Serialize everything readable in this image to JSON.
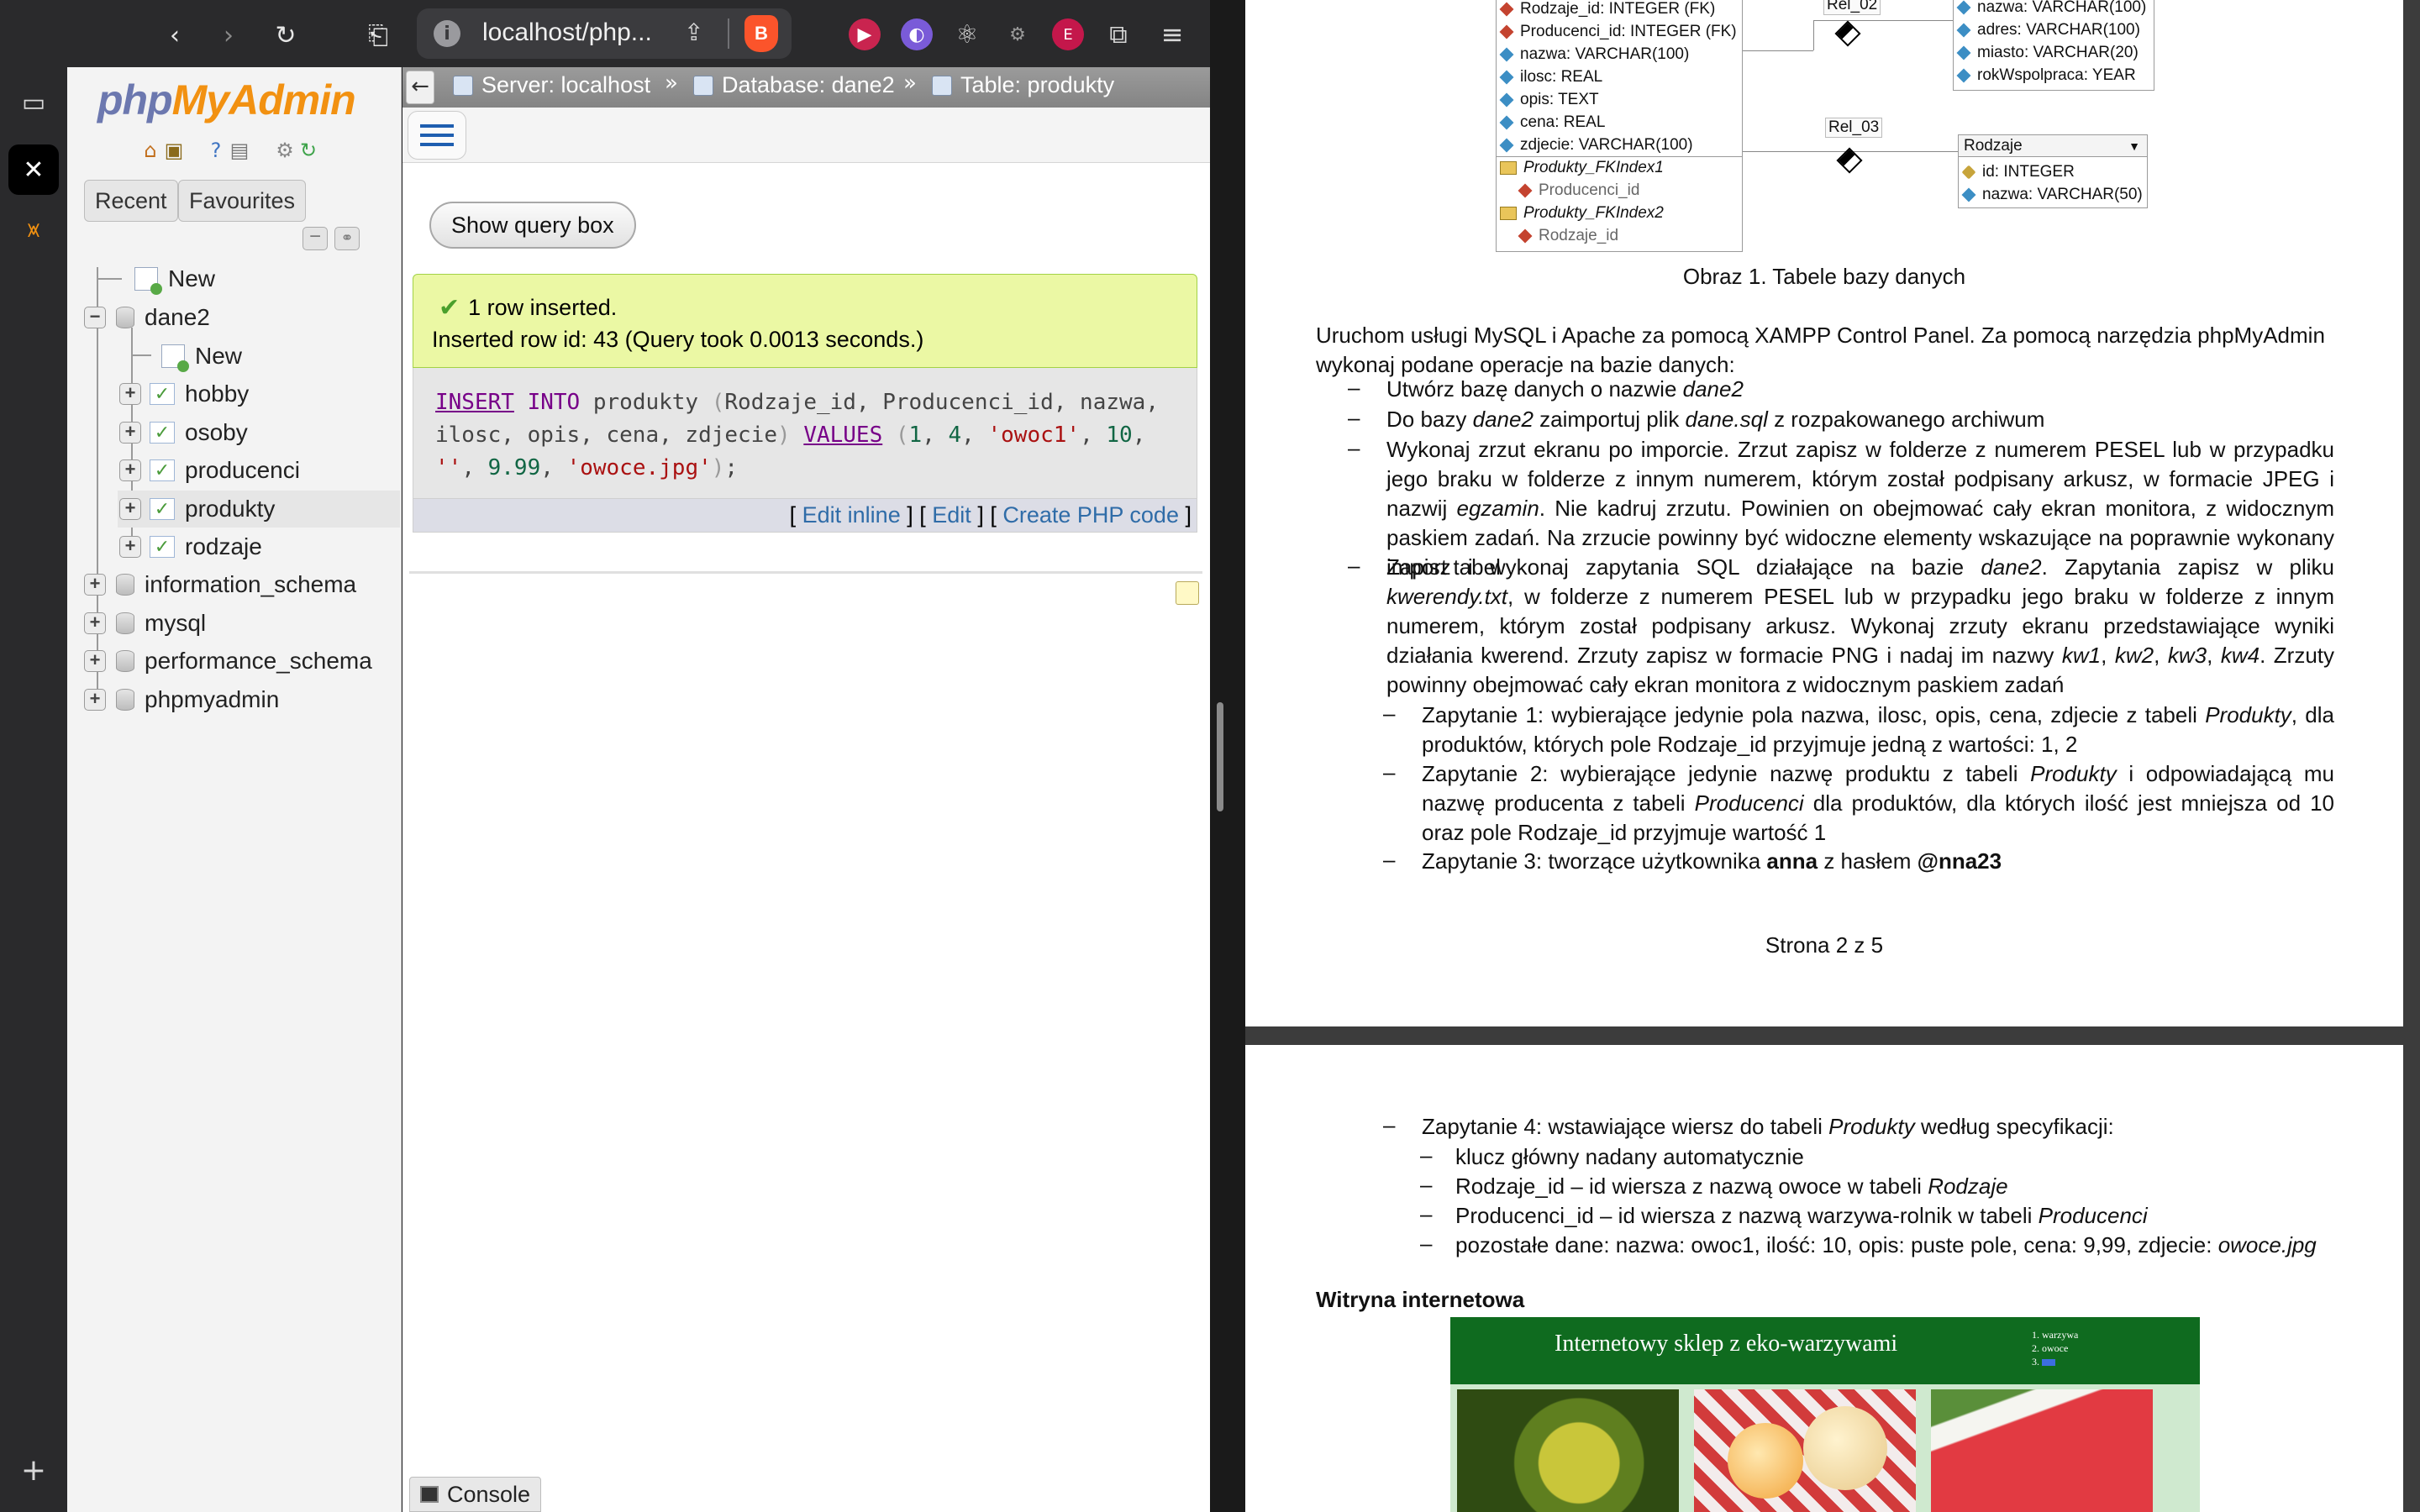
{
  "browser": {
    "url": "localhost/php...",
    "url_info_glyph": "i",
    "nav": {
      "back": "‹",
      "forward": "›",
      "reload": "↻",
      "bookmark": "⎗",
      "share": "⇪",
      "extensions": "⧉",
      "menu": "≡"
    },
    "extension_icons": [
      "play-icon",
      "palette-icon",
      "react-icon",
      "robot-icon",
      "elementor-icon",
      "puzzle-icon"
    ]
  },
  "sidebar_strip": {
    "panel_glyph": "▭",
    "close_glyph": "✕",
    "add_glyph": "+"
  },
  "pma": {
    "logo_php": "php",
    "logo_myadmin": "MyAdmin",
    "tabs": [
      "Recent",
      "Favourites"
    ],
    "tree": {
      "new_root": "New",
      "db_dane2": "dane2",
      "new_in_dane2": "New",
      "tables": [
        "hobby",
        "osoby",
        "producenci",
        "produkty",
        "rodzaje"
      ],
      "other_dbs": [
        "information_schema",
        "mysql",
        "performance_schema",
        "phpmyadmin"
      ],
      "toggle_expanded": "−",
      "toggle_collapsed": "+"
    },
    "breadcrumb": {
      "server": "Server: localhost",
      "database": "Database: dane2",
      "table": "Table: produkty",
      "separator": "»",
      "back_glyph": "←"
    },
    "show_query_box": "Show query box",
    "success": {
      "line1": "1 row inserted.",
      "line2": "Inserted row id: 43 (Query took 0.0013 seconds.)"
    },
    "sql": {
      "insert": "INSERT",
      "into": "INTO",
      "table": "produkty",
      "columns": "Rodzaje_id, Producenci_id, nazwa, ilosc, opis, cena, zdjecie",
      "values_kw": "VALUES",
      "v1": "1",
      "v2": "4",
      "v3": "'owoc1'",
      "v4": "10",
      "v5": "''",
      "v6": "9.99",
      "v7": "'owoce.jpg'"
    },
    "actions": {
      "open": "[",
      "edit_inline": "Edit inline",
      "mid1": "] [",
      "edit": "Edit",
      "mid2": "] [",
      "create_php": "Create PHP code",
      "close": "]"
    },
    "console": "Console"
  },
  "doc": {
    "er": {
      "produkty_rows": [
        "Rodzaje_id: INTEGER (FK)",
        "Producenci_id: INTEGER (FK)",
        "nazwa: VARCHAR(100)",
        "ilosc: REAL",
        "opis: TEXT",
        "cena: REAL",
        "zdjecie: VARCHAR(100)"
      ],
      "idx1": "Produkty_FKIndex1",
      "idx1_col": "Producenci_id",
      "idx2": "Produkty_FKIndex2",
      "idx2_col": "Rodzaje_id",
      "producenci_rows": [
        "nazwa: VARCHAR(100)",
        "adres: VARCHAR(100)",
        "miasto: VARCHAR(20)",
        "rokWspolpraca: YEAR"
      ],
      "rel02": "Rel_02",
      "rel03": "Rel_03",
      "rodzaje_title": "Rodzaje",
      "rodzaje_rows": [
        "id: INTEGER",
        "nazwa: VARCHAR(50)"
      ]
    },
    "caption": "Obraz 1. Tabele bazy danych",
    "intro": "Uruchom usługi MySQL i Apache za pomocą XAMPP Control Panel. Za pomocą narzędzia phpMyAdmin wykonaj podane operacje na bazie danych:",
    "dash": "–",
    "items": {
      "i1_a": "Utwórz bazę danych o nazwie ",
      "i1_b": "dane2",
      "i2_a": "Do bazy ",
      "i2_b": "dane2",
      "i2_c": " zaimportuj plik ",
      "i2_d": "dane.sql",
      "i2_e": " z rozpakowanego archiwum",
      "i3_a": "Wykonaj zrzut ekranu po imporcie. Zrzut zapisz w folderze z numerem PESEL lub w przypadku jego braku w folderze z innym numerem, którym został podpisany arkusz, w formacie JPEG i nazwij ",
      "i3_b": "egzamin",
      "i3_c": ". Nie kadruj zrzutu. Powinien on obejmować cały ekran monitora, z widocznym paskiem zadań. Na zrzucie powinny być widoczne elementy wskazujące na poprawnie wykonany import tabel",
      "i4_a": "Zapisz i wykonaj zapytania SQL działające na bazie ",
      "i4_b": "dane2",
      "i4_c": ". Zapytania zapisz w pliku ",
      "i4_d": "kwerendy.txt",
      "i4_e": ", w folderze z numerem PESEL lub w przypadku jego braku w folderze z innym numerem, którym został podpisany arkusz. Wykonaj zrzuty ekranu przedstawiające wyniki działania kwerend. Zrzuty zapisz w formacie PNG i nadaj im nazwy ",
      "i4_f": "kw1",
      "i4_g": ", ",
      "i4_h": "kw2",
      "i4_i": ", ",
      "i4_j": "kw3",
      "i4_k": ", ",
      "i4_l": "kw4",
      "i4_m": ". Zrzuty powinny obejmować cały ekran monitora z widocznym paskiem zadań",
      "q1_a": "Zapytanie 1: wybierające jedynie pola nazwa, ilosc, opis, cena, zdjecie z tabeli ",
      "q1_b": "Produkty",
      "q1_c": ", dla produktów, których pole Rodzaje_id przyjmuje jedną z wartości: 1, 2",
      "q2_a": "Zapytanie 2: wybierające jedynie nazwę produktu z tabeli ",
      "q2_b": "Produkty",
      "q2_c": " i odpowiadającą mu nazwę producenta z tabeli ",
      "q2_d": "Producenci",
      "q2_e": " dla produktów, dla których ilość jest mniejsza od 10 oraz pole Rodzaje_id przyjmuje wartość 1",
      "q3_a": "Zapytanie 3: tworzące użytkownika ",
      "q3_b": "anna",
      "q3_c": " z hasłem ",
      "q3_d": "@nna23",
      "q4_a": "Zapytanie 4: wstawiające wiersz do tabeli ",
      "q4_b": "Produkty",
      "q4_c": " według specyfikacji:",
      "q4s1": "klucz główny nadany automatycznie",
      "q4s2_a": "Rodzaje_id – id wiersza z nazwą owoce w tabeli ",
      "q4s2_b": "Rodzaje",
      "q4s3_a": "Producenci_id – id wiersza z nazwą warzywa-rolnik w tabeli ",
      "q4s3_b": "Producenci",
      "q4s4_a": "pozostałe dane: nazwa: owoc1, ilość: 10, opis: puste pole, cena: 9,99, zdjecie: ",
      "q4s4_b": "owoce.jpg"
    },
    "page_number": "Strona 2 z 5",
    "section": "Witryna internetowa",
    "site": {
      "title": "Internetowy sklep z eko-warzywami",
      "menu": [
        "1. warzywa",
        "2. owoce",
        "3. "
      ]
    }
  }
}
